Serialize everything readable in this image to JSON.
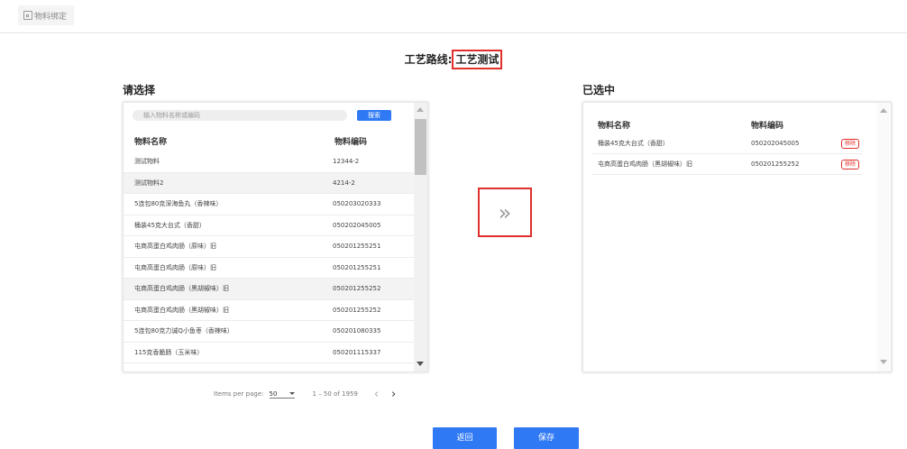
{
  "tab": {
    "label": "物料绑定"
  },
  "route": {
    "prefix": "工艺路线:",
    "name": "工艺测试"
  },
  "left": {
    "title": "请选择",
    "search": {
      "placeholder": "输入物料名称或编码",
      "button": "搜索"
    },
    "columns": [
      "物料名称",
      "物料编码"
    ],
    "rows": [
      {
        "name": "测试物料",
        "code": "12344-2"
      },
      {
        "name": "测试物料2",
        "code": "4214-2"
      },
      {
        "name": "5连包80克深海鱼丸（香辣味）",
        "code": "050203020333"
      },
      {
        "name": "桶装45克大台式（香甜）",
        "code": "050202045005"
      },
      {
        "name": "屯商高蛋白鸡肉肠（原味）旧",
        "code": "050201255251"
      },
      {
        "name": "屯商高蛋白鸡肉肠（原味）旧",
        "code": "050201255251"
      },
      {
        "name": "屯商高蛋白鸡肉肠（黑胡椒味）旧",
        "code": "050201255252"
      },
      {
        "name": "屯商高蛋白鸡肉肠（黑胡椒味）旧",
        "code": "050201255252"
      },
      {
        "name": "5连包80克力诚Q小鱼枣（香辣味）",
        "code": "050201080335"
      },
      {
        "name": "115克香脆肠（玉米味）",
        "code": "050201115337"
      }
    ]
  },
  "transfer": {
    "icon": "double-chevron-right-icon",
    "glyph": "»"
  },
  "right": {
    "title": "已选中",
    "columns": [
      "物料名称",
      "物料编码"
    ],
    "remove_label": "移除",
    "rows": [
      {
        "name": "桶装45克大台式（香甜）",
        "code": "050202045005"
      },
      {
        "name": "屯商高蛋白鸡肉肠（黑胡椒味）旧",
        "code": "050201255252"
      }
    ]
  },
  "paginator": {
    "items_per_page_label": "Items per page:",
    "page_size": "50",
    "range": "1 – 50 of 1959"
  },
  "buttons": {
    "back": "返回",
    "save": "保存"
  },
  "colors": {
    "accent": "#2f79f4",
    "highlight": "#e0302b"
  }
}
